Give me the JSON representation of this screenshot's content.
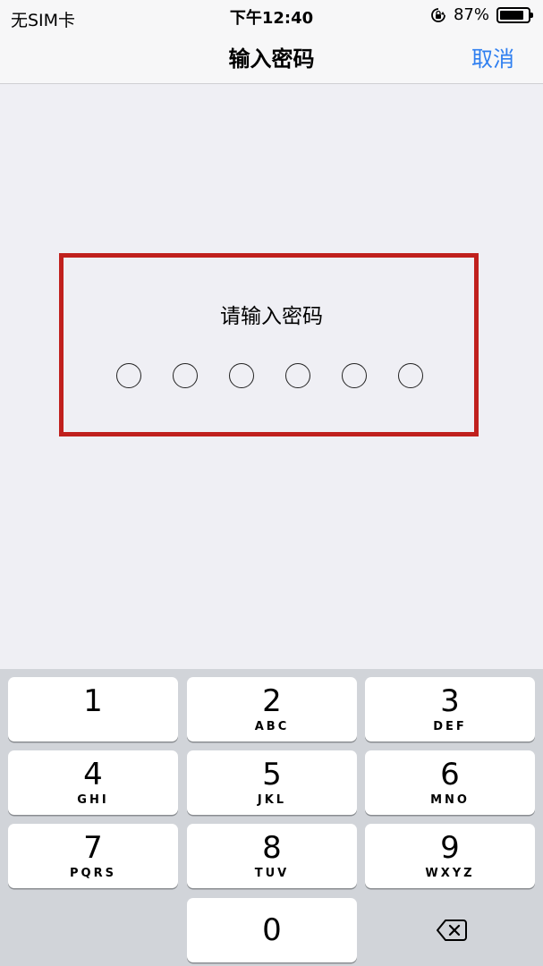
{
  "status": {
    "carrier": "无SIM卡",
    "time": "下午12:40",
    "battery": "87%",
    "battery_level": 0.87
  },
  "nav": {
    "title": "输入密码",
    "cancel": "取消"
  },
  "prompt": "请输入密码",
  "passcode_length": 6,
  "keypad": [
    {
      "num": "1",
      "letters": ""
    },
    {
      "num": "2",
      "letters": "ABC"
    },
    {
      "num": "3",
      "letters": "DEF"
    },
    {
      "num": "4",
      "letters": "GHI"
    },
    {
      "num": "5",
      "letters": "JKL"
    },
    {
      "num": "6",
      "letters": "MNO"
    },
    {
      "num": "7",
      "letters": "PQRS"
    },
    {
      "num": "8",
      "letters": "TUV"
    },
    {
      "num": "9",
      "letters": "WXYZ"
    },
    {
      "num": "0",
      "letters": ""
    }
  ],
  "colors": {
    "accent": "#2f7ff0",
    "highlight": "#c0201d"
  },
  "icons": {
    "rotation_lock": "rotation-lock-icon",
    "battery": "battery-icon",
    "delete": "delete-backspace-icon"
  }
}
